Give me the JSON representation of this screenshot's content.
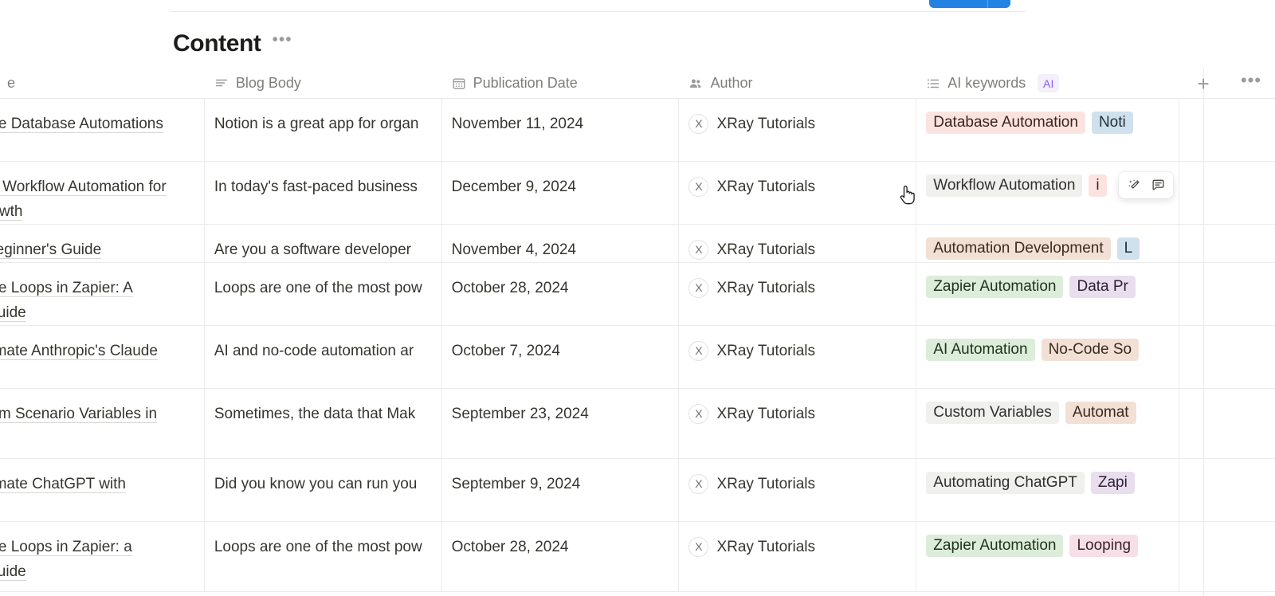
{
  "toolbar": {
    "primary_button_label": ""
  },
  "header": {
    "title": "Content",
    "menu_label": "•••"
  },
  "columns": [
    {
      "key": "title",
      "label": "e",
      "icon": "title-icon"
    },
    {
      "key": "body",
      "label": "Blog Body",
      "icon": "text-icon"
    },
    {
      "key": "date",
      "label": "Publication Date",
      "icon": "calendar-icon"
    },
    {
      "key": "author",
      "label": "Author",
      "icon": "person-group-icon"
    },
    {
      "key": "keywords",
      "label": "AI keywords",
      "icon": "multi-select-icon",
      "badge": "AI"
    }
  ],
  "column_actions": {
    "add_label": "+",
    "more_label": "•••"
  },
  "rows": [
    {
      "title": "ate Database Automations",
      "body": "Notion is a great app for organ",
      "date": "November 11, 2024",
      "author": "XRay Tutorials",
      "author_initial": "X",
      "tags": [
        {
          "label": "Database Automation",
          "bg": "#fbe4e0",
          "fg": "#3c2420"
        },
        {
          "label": "Noti",
          "bg": "#cfe1ec",
          "fg": "#22313a"
        }
      ]
    },
    {
      "title": "of Workflow Automation for\nrowth",
      "body": "In today's fast-paced business",
      "date": "December 9, 2024",
      "author": "XRay Tutorials",
      "author_initial": "X",
      "tags": [
        {
          "label": "Workflow Automation",
          "bg": "#f0f0ef",
          "fg": "#32302c"
        },
        {
          "label": "i",
          "bg": "#fbe4e0",
          "fg": "#3c2420"
        }
      ]
    },
    {
      "title": "Beginner's Guide",
      "body": "Are you a software developer",
      "date": "November 4, 2024",
      "author": "XRay Tutorials",
      "author_initial": "X",
      "tags": [
        {
          "label": "Automation Development",
          "bg": "#f3e0d5",
          "fg": "#3a2a1e"
        },
        {
          "label": "L",
          "bg": "#cfe1ec",
          "fg": "#22313a"
        }
      ]
    },
    {
      "title": "ate Loops in Zapier: A\nGuide",
      "body": "Loops are one of the most pow",
      "date": "October 28, 2024",
      "author": "XRay Tutorials",
      "author_initial": "X",
      "tags": [
        {
          "label": "Zapier Automation",
          "bg": "#dcedd9",
          "fg": "#22331e"
        },
        {
          "label": "Data Pr",
          "bg": "#e8deee",
          "fg": "#2e2336"
        }
      ]
    },
    {
      "title": "omate Anthropic's Claude",
      "body": "AI and no-code automation ar",
      "date": "October 7, 2024",
      "author": "XRay Tutorials",
      "author_initial": "X",
      "tags": [
        {
          "label": "AI Automation",
          "bg": "#dcedd9",
          "fg": "#22331e"
        },
        {
          "label": "No-Code So",
          "bg": "#f3e0d5",
          "fg": "#3a2a1e"
        }
      ]
    },
    {
      "title": "tom Scenario Variables in",
      "body": "Sometimes, the data that Mak",
      "date": "September 23, 2024",
      "author": "XRay Tutorials",
      "author_initial": "X",
      "tags": [
        {
          "label": "Custom Variables",
          "bg": "#f0f0ef",
          "fg": "#32302c"
        },
        {
          "label": "Automat",
          "bg": "#f3e0d5",
          "fg": "#3a2a1e"
        }
      ]
    },
    {
      "title": "omate ChatGPT with",
      "body": "Did you know you can run you",
      "date": "September 9, 2024",
      "author": "XRay Tutorials",
      "author_initial": "X",
      "tags": [
        {
          "label": "Automating ChatGPT",
          "bg": "#f0f0ef",
          "fg": "#32302c"
        },
        {
          "label": "Zapi",
          "bg": "#e8deee",
          "fg": "#2e2336"
        }
      ]
    },
    {
      "title": "ate Loops in Zapier: a\nGuide",
      "body": "Loops are one of the most pow",
      "date": "October 28, 2024",
      "author": "XRay Tutorials",
      "author_initial": "X",
      "tags": [
        {
          "label": "Zapier Automation",
          "bg": "#dcedd9",
          "fg": "#22331e"
        },
        {
          "label": "Looping",
          "bg": "#f7dfe7",
          "fg": "#3a222c"
        }
      ]
    }
  ],
  "hover_toolbar": {
    "ai_label": "ai-sparkle",
    "comment_label": "comment"
  },
  "colors": {
    "accent_blue": "#2383e2",
    "ai_purple": "#8b5cf0",
    "border": "#ebebea",
    "muted_text": "#7f7e79"
  }
}
